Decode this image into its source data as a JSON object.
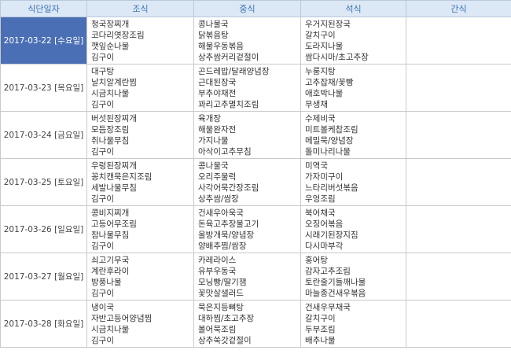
{
  "headers": [
    "식단일자",
    "조식",
    "중식",
    "석식",
    "간식"
  ],
  "rows": [
    {
      "date": "2017-03-22 [수요일]",
      "selected": true,
      "breakfast": [
        "청국장찌개",
        "코다리엿장조림",
        "깻잎순나물",
        "김구이"
      ],
      "lunch": [
        "콩나물국",
        "닭볶음탕",
        "해물우동볶음",
        "상추쌈커리겉절이"
      ],
      "dinner": [
        "우거지된장국",
        "갈치구이",
        "도라지나물",
        "쌈다시마/초고추장"
      ],
      "snack": []
    },
    {
      "date": "2017-03-23 [목요일]",
      "selected": false,
      "breakfast": [
        "대구탕",
        "날치알계란찜",
        "시금치나물",
        "김구이"
      ],
      "lunch": [
        "곤드레밥/달래양념장",
        "근대된장국",
        "부추야채전",
        "꽈리고추멸치조림"
      ],
      "dinner": [
        "누룽지탕",
        "고추잡채/꽃빵",
        "애호박나물",
        "무생채"
      ],
      "snack": []
    },
    {
      "date": "2017-03-24 [금요일]",
      "selected": false,
      "breakfast": [
        "버섯된장찌개",
        "모듬장조림",
        "취나물무침",
        "김구이"
      ],
      "lunch": [
        "육개장",
        "해물완자전",
        "가지나물",
        "아삭이고추무침"
      ],
      "dinner": [
        "수제비국",
        "미트볼케찹조림",
        "메밀묵/양념장",
        "돌미나리나물"
      ],
      "snack": []
    },
    {
      "date": "2017-03-25 [토요일]",
      "selected": false,
      "breakfast": [
        "우렁된장찌개",
        "꽁치캔묵은지조림",
        "세발나물무침",
        "김구이"
      ],
      "lunch": [
        "콩나물국",
        "오리주물럭",
        "사각어묵간장조림",
        "상추쌈/쌈장"
      ],
      "dinner": [
        "미역국",
        "가자미구이",
        "느타리버섯볶음",
        "우엉조림"
      ],
      "snack": []
    },
    {
      "date": "2017-03-26 [일요일]",
      "selected": false,
      "breakfast": [
        "콩비지찌개",
        "고등어무조림",
        "참나물무침",
        "김구이"
      ],
      "lunch": [
        "건새우아욱국",
        "돈육고추장불고기",
        "올방개묵/양념장",
        "양배추찜/쌈장"
      ],
      "dinner": [
        "북어채국",
        "오징어볶음",
        "시래기된장지짐",
        "다시마부각"
      ],
      "snack": []
    },
    {
      "date": "2017-03-27 [월요일]",
      "selected": false,
      "breakfast": [
        "쇠고기무국",
        "계란후라이",
        "방풍나물",
        "김구이"
      ],
      "lunch": [
        "카레라이스",
        "유부우동국",
        "모닝빵/딸기잼",
        "꽃맛살샐러드"
      ],
      "dinner": [
        "홍어탕",
        "감자고추조림",
        "토란줄기들깨나물",
        "마늘종건새우볶음"
      ],
      "snack": []
    },
    {
      "date": "2017-03-28 [화요일]",
      "selected": false,
      "breakfast": [
        "냉이국",
        "자반고등어양념찜",
        "시금치나물",
        "김구이"
      ],
      "lunch": [
        "묵은지등뼈탕",
        "대하찜/초고추장",
        "볼어묵조림",
        "상추쑥갓겉절이"
      ],
      "dinner": [
        "건새우무채국",
        "갈치구이",
        "두부조림",
        "배추나물"
      ],
      "snack": []
    }
  ]
}
